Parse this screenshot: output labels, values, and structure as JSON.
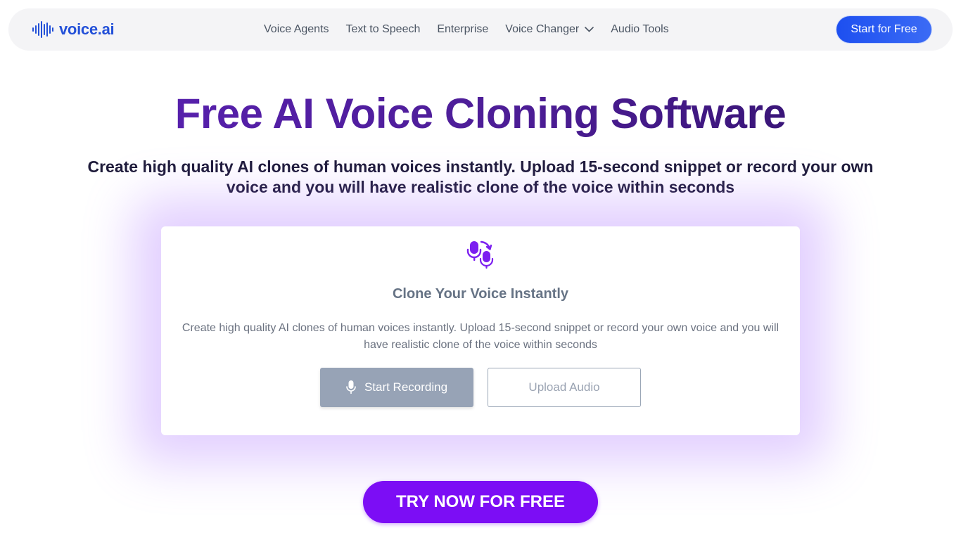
{
  "brand": {
    "name": "voice.ai",
    "color": "#2350d8"
  },
  "nav": {
    "links": [
      {
        "label": "Voice Agents"
      },
      {
        "label": "Text to Speech"
      },
      {
        "label": "Enterprise"
      },
      {
        "label": "Voice Changer",
        "has_dropdown": true
      },
      {
        "label": "Audio Tools"
      }
    ],
    "cta_label": "Start for Free"
  },
  "hero": {
    "title": "Free AI Voice Cloning Software",
    "subtitle": "Create high quality AI clones of human voices instantly. Upload 15-second snippet or record your own voice and you will have realistic clone of the voice within seconds"
  },
  "card": {
    "icon": "voice-clone-icon",
    "title": "Clone Your Voice Instantly",
    "description": "Create high quality AI clones of human voices instantly. Upload 15-second snippet or record your own voice and you will have realistic clone of the voice within seconds",
    "record_label": "Start Recording",
    "record_icon": "microphone-icon",
    "upload_label": "Upload Audio"
  },
  "cta_bottom": {
    "label": "TRY NOW FOR FREE",
    "color": "#7c0df5"
  },
  "colors": {
    "accent": "#7c0df5",
    "nav_cta": "#1d4ff0",
    "title_gradient_start": "#5b21b6",
    "title_gradient_end": "#2e1065"
  }
}
